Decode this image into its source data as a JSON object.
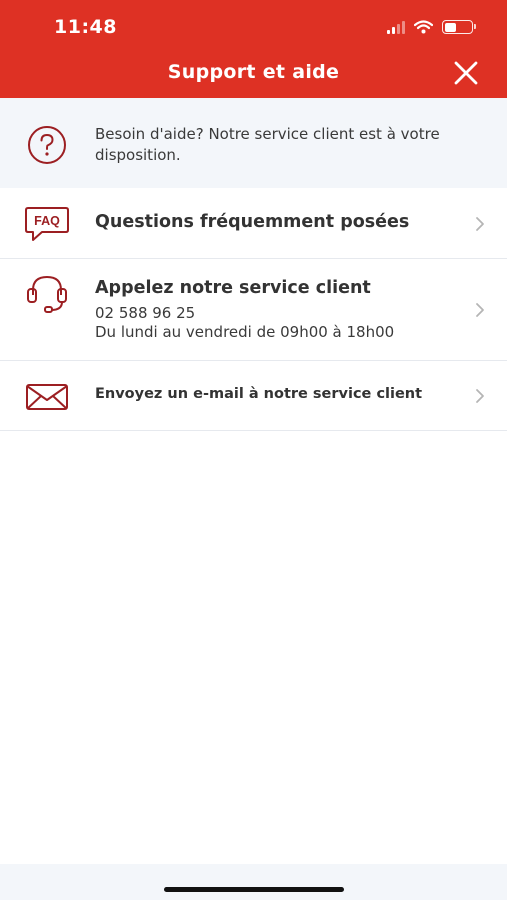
{
  "status_bar": {
    "time": "11:48"
  },
  "header": {
    "title": "Support et aide"
  },
  "info": {
    "text": "Besoin d'aide? Notre service client est à votre disposition."
  },
  "items": [
    {
      "title": "Questions fréquemment posées",
      "icon": "faq-icon"
    },
    {
      "title": "Appelez notre service client",
      "phone": "02 588 96 25",
      "hours": "Du lundi au vendredi de 09h00 à 18h00",
      "icon": "headset-icon"
    },
    {
      "title": "Envoyez un e-mail à notre service client",
      "icon": "envelope-icon"
    }
  ],
  "colors": {
    "accent": "#de3124",
    "icon": "#9c1f22",
    "background": "#f3f6fa"
  }
}
